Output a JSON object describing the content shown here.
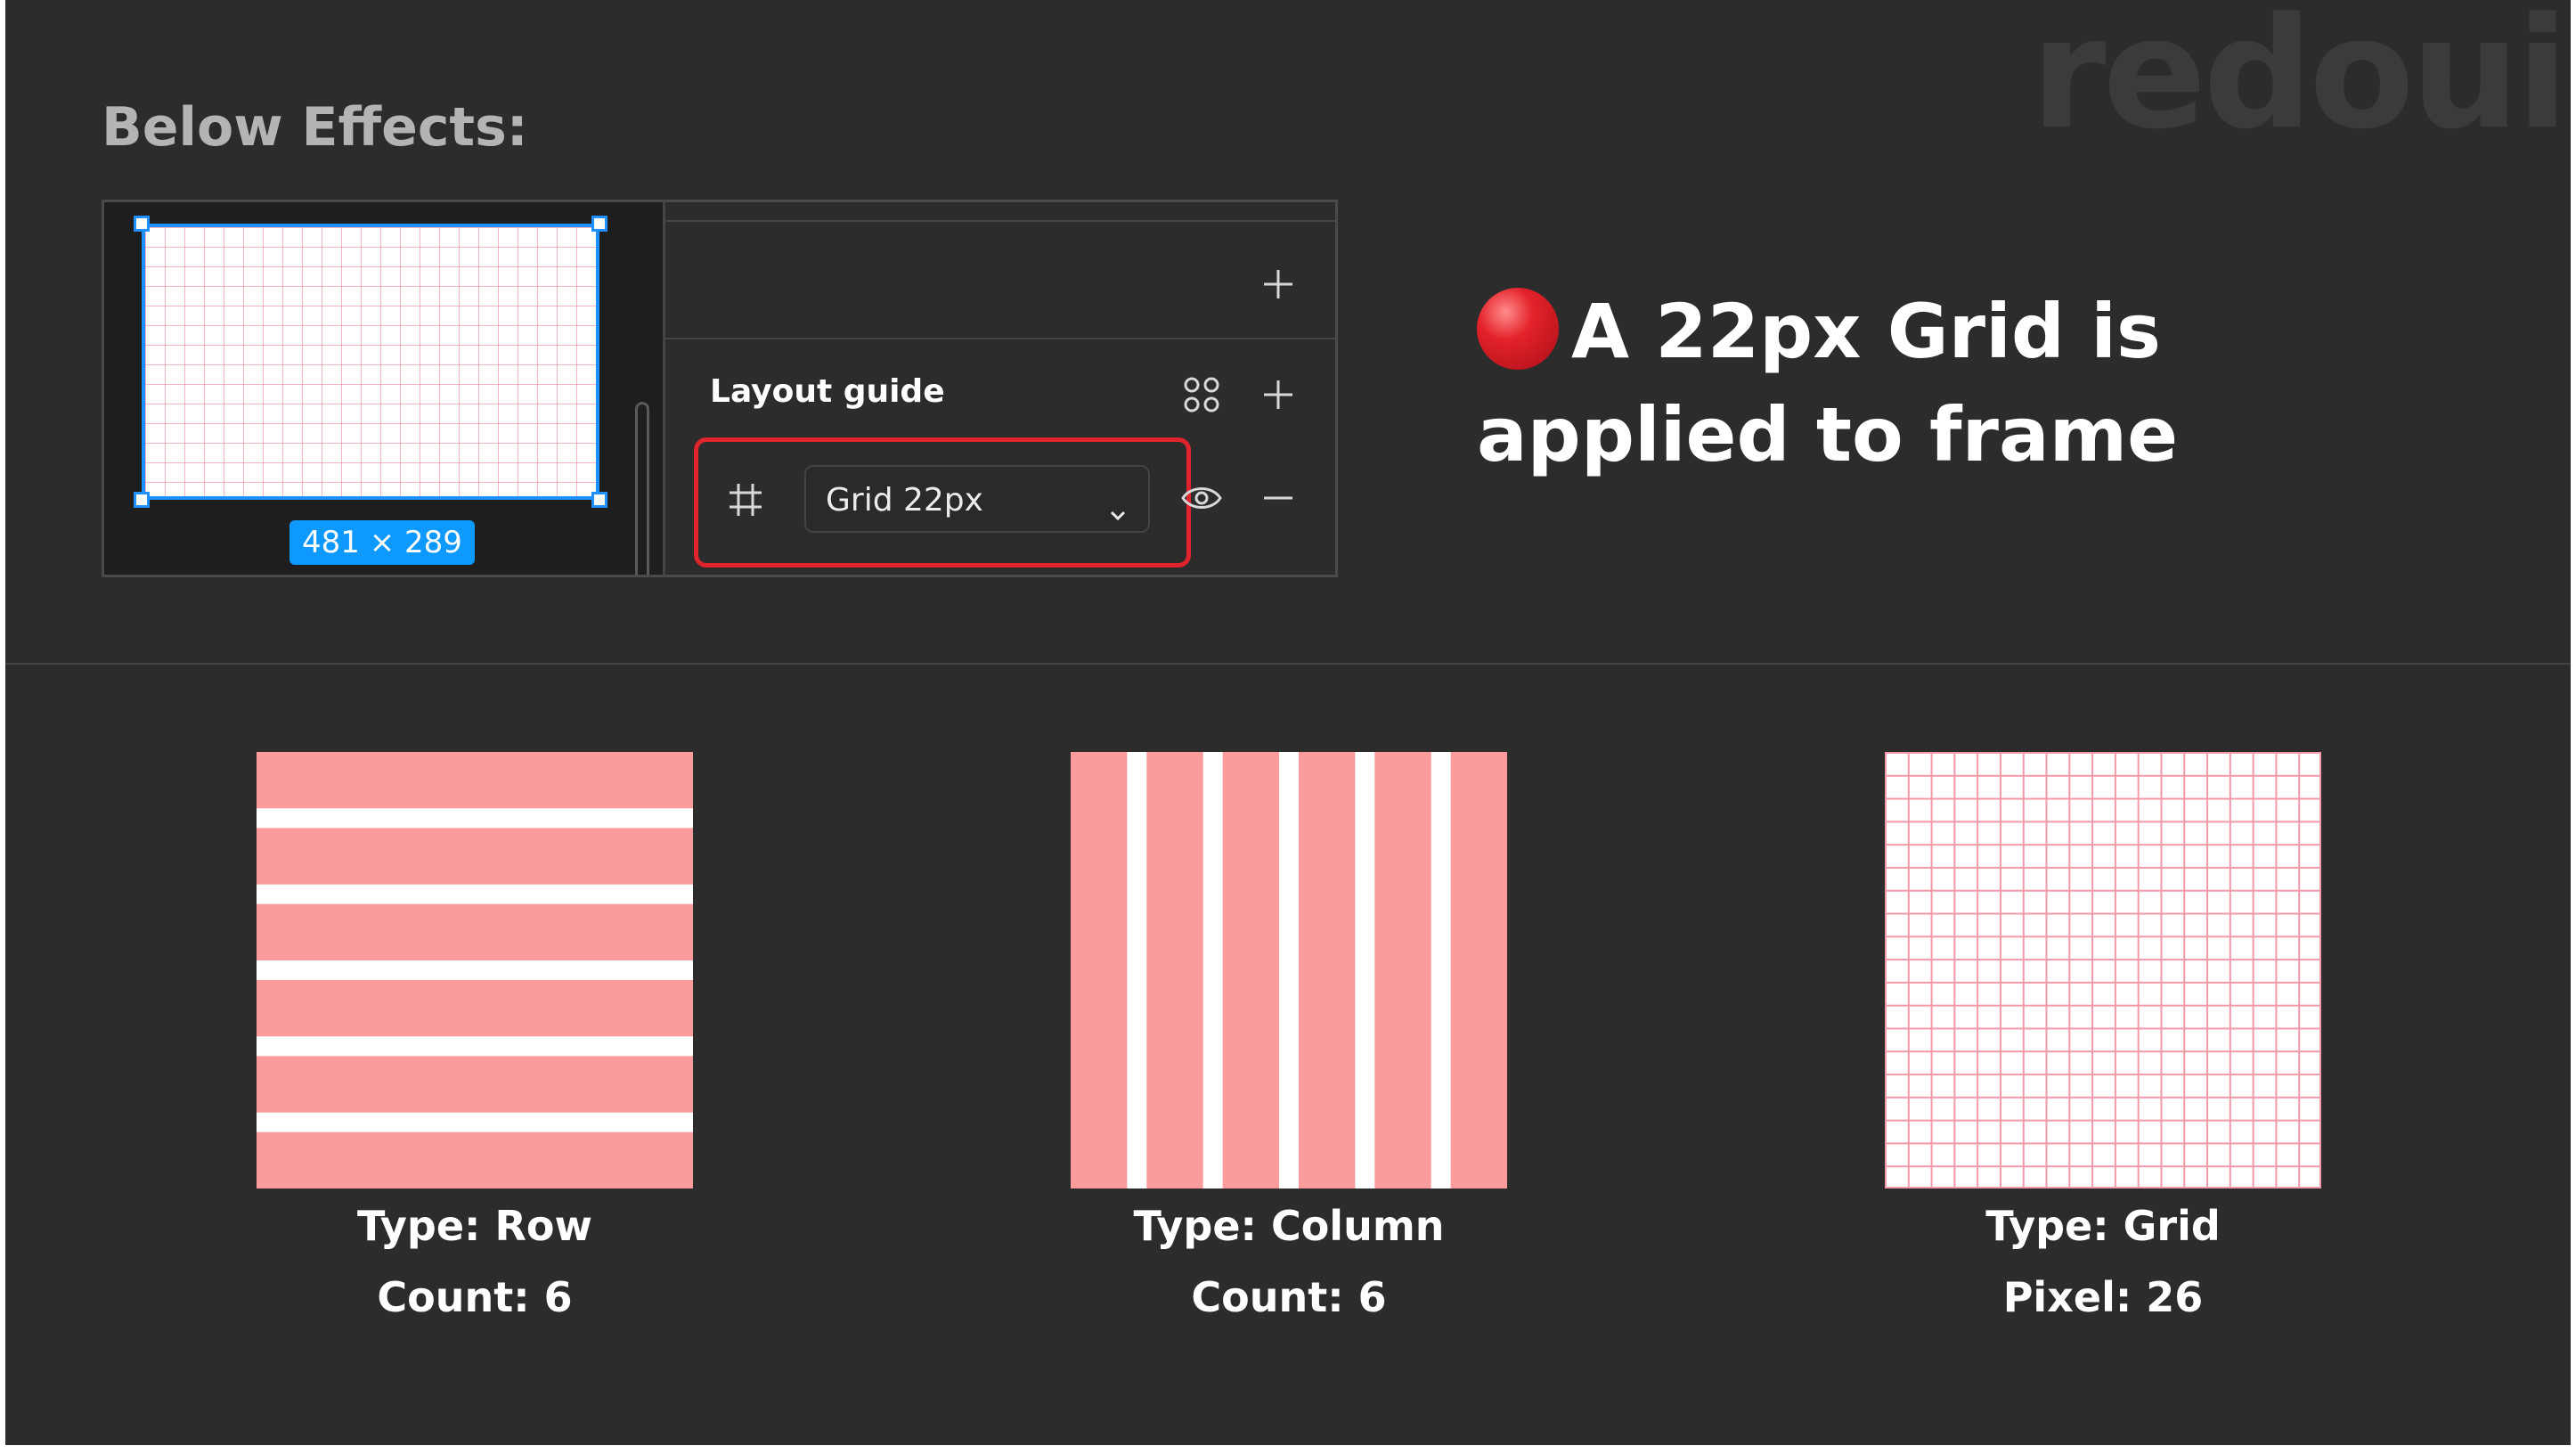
{
  "brand": "redoui",
  "section_title": "Below Effects:",
  "panel": {
    "frame_size": "481 × 289",
    "layout_guide_label": "Layout guide",
    "grid_select_value": "Grid 22px",
    "icons": {
      "add_top": "plus-icon",
      "styles": "grid-styles-icon",
      "add_layout": "plus-icon",
      "grid": "hash-grid-icon",
      "chevron": "chevron-down-icon",
      "visibility": "eye-icon",
      "remove": "minus-icon"
    },
    "colors": {
      "selection": "#1e90ff",
      "badge": "#0d99ff",
      "highlight": "#e0242e",
      "grid_line": "#f0788c"
    }
  },
  "callout": {
    "line1": "A 22px Grid is",
    "line2": "applied to frame",
    "marker": "red-circle-icon"
  },
  "examples": [
    {
      "type_label": "Type: Row",
      "detail_label": "Count: 6",
      "kind": "row",
      "count": 6
    },
    {
      "type_label": "Type: Column",
      "detail_label": "Count: 6",
      "kind": "column",
      "count": 6
    },
    {
      "type_label": "Type: Grid",
      "detail_label": "Pixel: 26",
      "kind": "grid",
      "pixel": 26
    }
  ],
  "swatch_color": "#fb9b9b"
}
